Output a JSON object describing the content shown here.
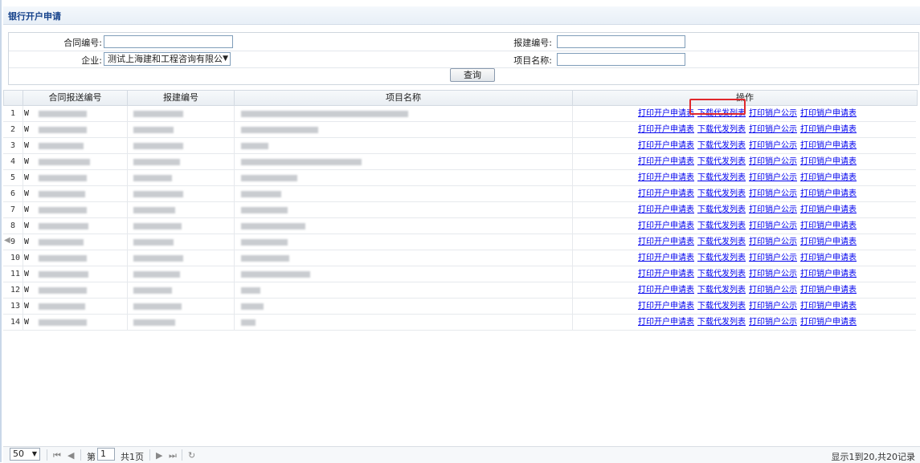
{
  "page": {
    "title": "银行开户申请"
  },
  "search": {
    "contract_no_label": "合同编号:",
    "contract_no_value": "",
    "report_no_label": "报建编号:",
    "report_no_value": "",
    "company_label": "企业:",
    "company_value": "测试上海建和工程咨询有限公",
    "project_name_label": "项目名称:",
    "project_name_value": "",
    "query_button": "查询"
  },
  "grid": {
    "columns": [
      "合同报送编号",
      "报建编号",
      "项目名称",
      "操作"
    ],
    "row_prefix": "W",
    "actions": [
      "打印开户申请表",
      "下载代发列表",
      "打印销户公示",
      "打印销户申请表"
    ],
    "rows": [
      {
        "n": "1"
      },
      {
        "n": "2"
      },
      {
        "n": "3"
      },
      {
        "n": "4"
      },
      {
        "n": "5"
      },
      {
        "n": "6"
      },
      {
        "n": "7"
      },
      {
        "n": "8"
      },
      {
        "n": "9"
      },
      {
        "n": "10"
      },
      {
        "n": "11"
      },
      {
        "n": "12"
      },
      {
        "n": "13"
      },
      {
        "n": "14"
      }
    ],
    "highlighted_action": "下载代发列表"
  },
  "pager": {
    "page_size": "50",
    "page_prefix": "第",
    "page_value": "1",
    "total_pages": "共1页",
    "summary": "显示1到20,共20记录"
  },
  "colors": {
    "link": "#0000ee",
    "highlight": "#e0282c",
    "title": "#15428b"
  }
}
